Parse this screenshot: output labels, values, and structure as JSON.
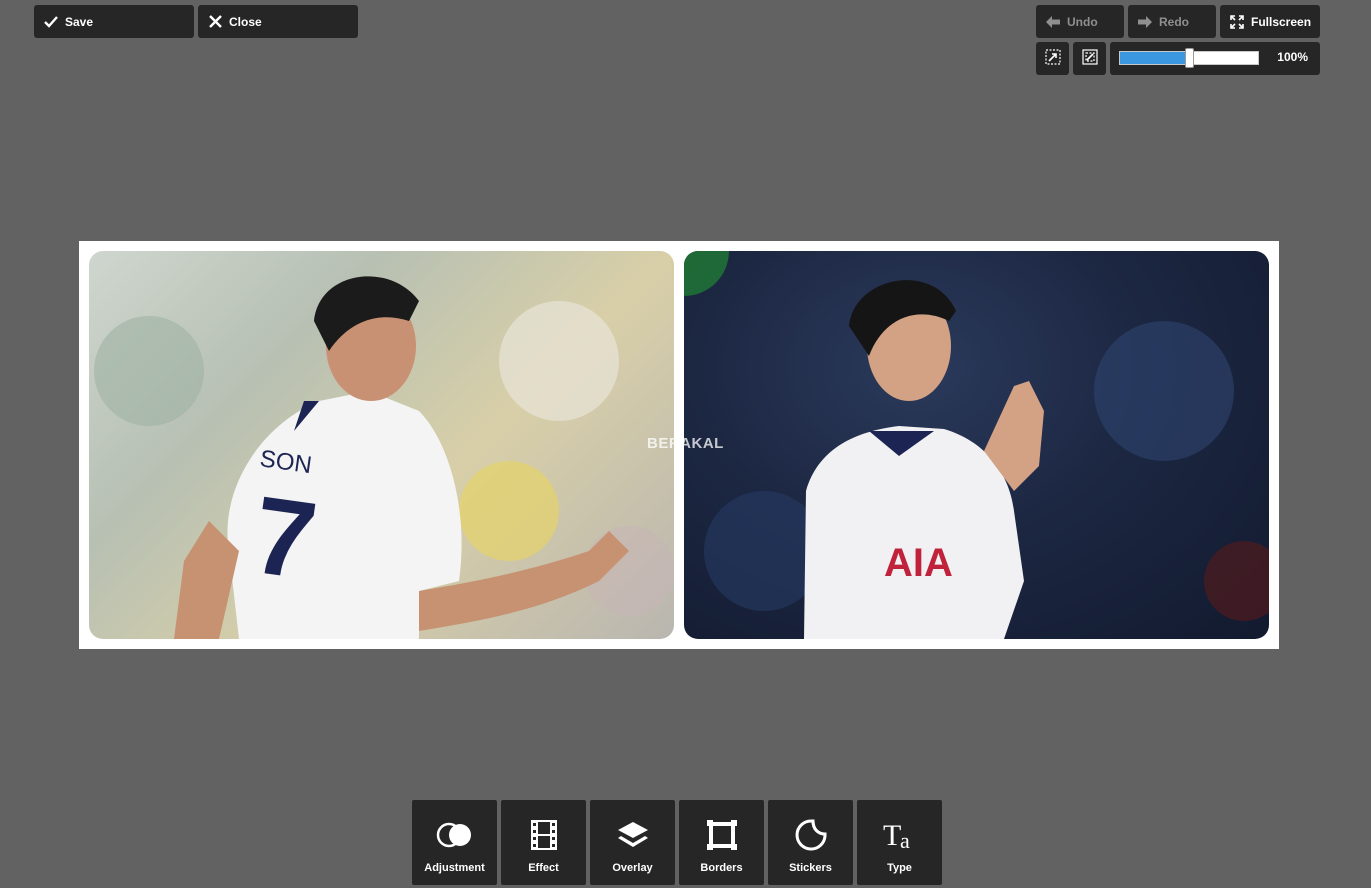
{
  "top_left": {
    "save_label": "Save",
    "close_label": "Close"
  },
  "top_right": {
    "undo_label": "Undo",
    "redo_label": "Redo",
    "fullscreen_label": "Fullscreen"
  },
  "zoom": {
    "value_label": "100%",
    "level_fraction": 0.5
  },
  "canvas": {
    "watermark": "BERAKAL"
  },
  "photo1": {
    "jersey_name": "SON",
    "jersey_number": "7"
  },
  "tools": [
    {
      "label": "Adjustment",
      "icon": "adjustment-icon"
    },
    {
      "label": "Effect",
      "icon": "film-icon"
    },
    {
      "label": "Overlay",
      "icon": "layers-icon"
    },
    {
      "label": "Borders",
      "icon": "frame-icon"
    },
    {
      "label": "Stickers",
      "icon": "sticker-icon"
    },
    {
      "label": "Type",
      "icon": "text-icon"
    }
  ],
  "colors": {
    "background": "#626262",
    "button": "#262626",
    "accent": "#3a97e0"
  }
}
